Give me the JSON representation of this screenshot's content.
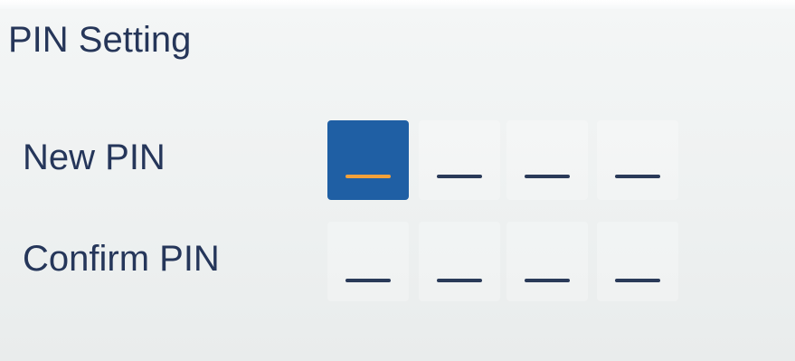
{
  "title": "PIN Setting",
  "rows": {
    "new": {
      "label": "New PIN",
      "active_digit": 1,
      "digits": [
        "_",
        "_",
        "_",
        "_"
      ]
    },
    "confirm": {
      "label": "Confirm PIN",
      "digits": [
        "_",
        "_",
        "_",
        "_"
      ]
    }
  },
  "colors": {
    "background": "#eef1f2",
    "text": "#263659",
    "active_cell": "#1f5fa4",
    "active_cursor": "#f3a13a",
    "dash": "#2a3a59"
  }
}
